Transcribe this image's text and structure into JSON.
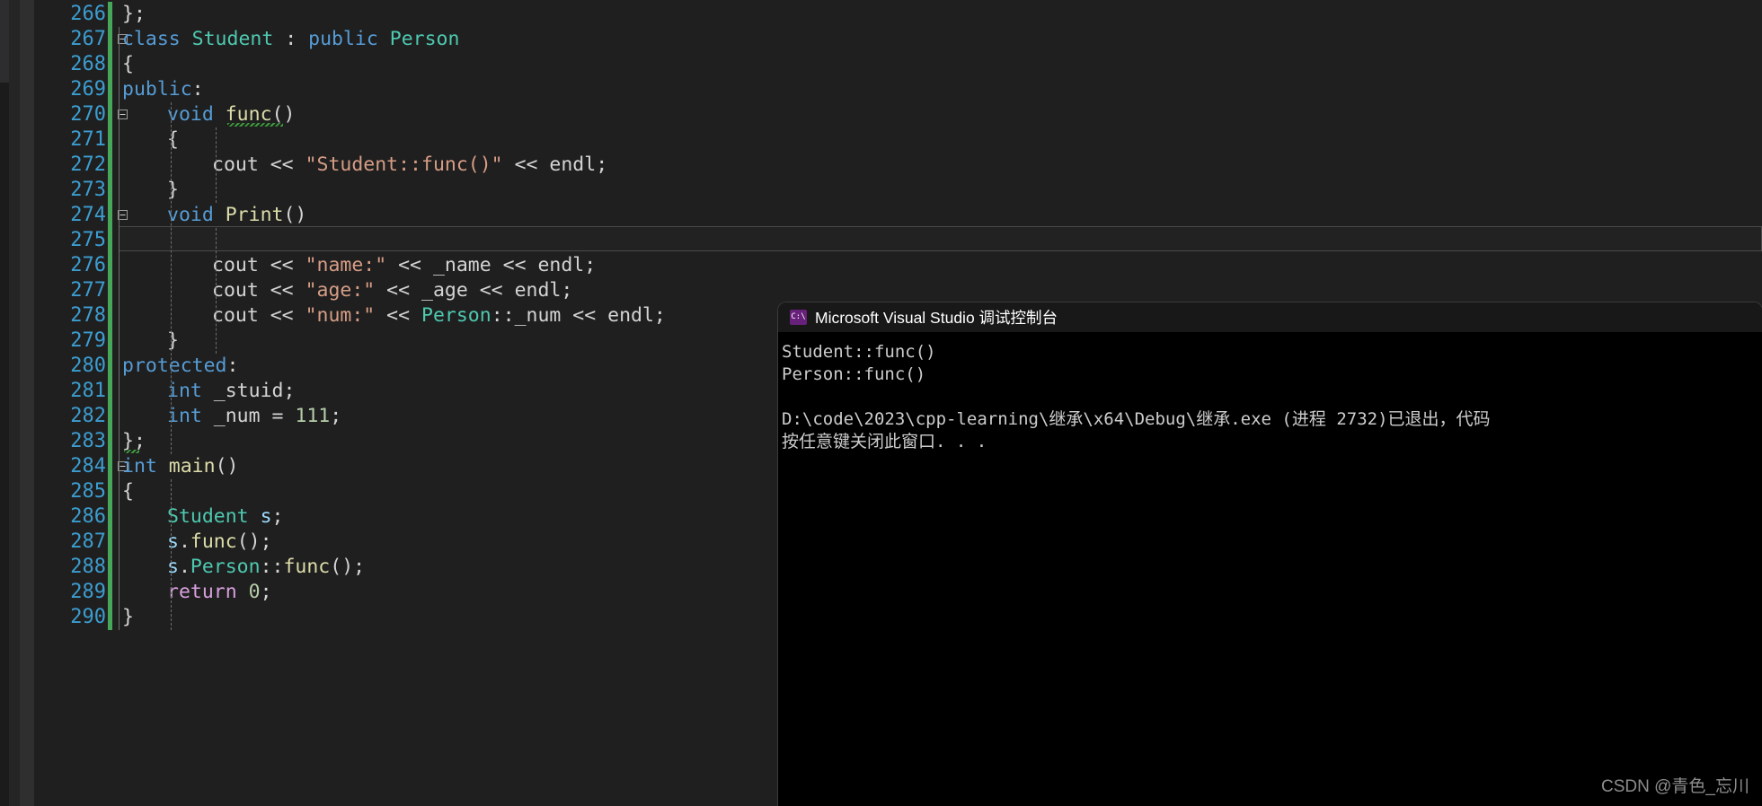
{
  "editor": {
    "first_line_number": 266,
    "lines": [
      {
        "n": "266",
        "fold": "",
        "indent": 0,
        "tokens": [
          {
            "t": "};",
            "c": "pl"
          }
        ]
      },
      {
        "n": "267",
        "fold": "minus",
        "indent": 0,
        "tokens": [
          {
            "t": "class ",
            "c": "kw"
          },
          {
            "t": "Student",
            "c": "ty"
          },
          {
            "t": " : ",
            "c": "pl"
          },
          {
            "t": "public",
            "c": "kw"
          },
          {
            "t": " ",
            "c": "pl"
          },
          {
            "t": "Person",
            "c": "ty"
          }
        ]
      },
      {
        "n": "268",
        "fold": "",
        "indent": 0,
        "tokens": [
          {
            "t": "{",
            "c": "pl"
          }
        ]
      },
      {
        "n": "269",
        "fold": "",
        "indent": 0,
        "tokens": [
          {
            "t": "public",
            "c": "kw"
          },
          {
            "t": ":",
            "c": "pl"
          }
        ]
      },
      {
        "n": "270",
        "fold": "minus",
        "indent": 1,
        "tokens": [
          {
            "t": "void",
            "c": "kw"
          },
          {
            "t": " ",
            "c": "pl"
          },
          {
            "t": "func",
            "c": "fn"
          },
          {
            "t": "()",
            "c": "pl"
          }
        ]
      },
      {
        "n": "271",
        "fold": "",
        "indent": 1,
        "tokens": [
          {
            "t": "{",
            "c": "pl"
          }
        ]
      },
      {
        "n": "272",
        "fold": "",
        "indent": 2,
        "tokens": [
          {
            "t": "cout",
            "c": "pl"
          },
          {
            "t": " << ",
            "c": "op"
          },
          {
            "t": "\"Student::func()\"",
            "c": "str"
          },
          {
            "t": " << ",
            "c": "op"
          },
          {
            "t": "endl",
            "c": "pl"
          },
          {
            "t": ";",
            "c": "pl"
          }
        ]
      },
      {
        "n": "273",
        "fold": "",
        "indent": 1,
        "tokens": [
          {
            "t": "}",
            "c": "pl"
          }
        ]
      },
      {
        "n": "274",
        "fold": "minus",
        "indent": 1,
        "tokens": [
          {
            "t": "void",
            "c": "kw"
          },
          {
            "t": " ",
            "c": "pl"
          },
          {
            "t": "Print",
            "c": "fn"
          },
          {
            "t": "()",
            "c": "pl"
          }
        ]
      },
      {
        "n": "275",
        "fold": "",
        "indent": 1,
        "tokens": [
          {
            "t": "{",
            "c": "pl"
          }
        ]
      },
      {
        "n": "276",
        "fold": "",
        "indent": 2,
        "tokens": [
          {
            "t": "cout",
            "c": "pl"
          },
          {
            "t": " << ",
            "c": "op"
          },
          {
            "t": "\"name:\"",
            "c": "str"
          },
          {
            "t": " << ",
            "c": "op"
          },
          {
            "t": "_name",
            "c": "pl"
          },
          {
            "t": " << ",
            "c": "op"
          },
          {
            "t": "endl",
            "c": "pl"
          },
          {
            "t": ";",
            "c": "pl"
          }
        ]
      },
      {
        "n": "277",
        "fold": "",
        "indent": 2,
        "tokens": [
          {
            "t": "cout",
            "c": "pl"
          },
          {
            "t": " << ",
            "c": "op"
          },
          {
            "t": "\"age:\"",
            "c": "str"
          },
          {
            "t": " << ",
            "c": "op"
          },
          {
            "t": "_age",
            "c": "pl"
          },
          {
            "t": " << ",
            "c": "op"
          },
          {
            "t": "endl",
            "c": "pl"
          },
          {
            "t": ";",
            "c": "pl"
          }
        ]
      },
      {
        "n": "278",
        "fold": "",
        "indent": 2,
        "tokens": [
          {
            "t": "cout",
            "c": "pl"
          },
          {
            "t": " << ",
            "c": "op"
          },
          {
            "t": "\"num:\"",
            "c": "str"
          },
          {
            "t": " << ",
            "c": "op"
          },
          {
            "t": "Person",
            "c": "ty"
          },
          {
            "t": "::_num",
            "c": "pl"
          },
          {
            "t": " << ",
            "c": "op"
          },
          {
            "t": "endl",
            "c": "pl"
          },
          {
            "t": ";",
            "c": "pl"
          }
        ]
      },
      {
        "n": "279",
        "fold": "",
        "indent": 1,
        "tokens": [
          {
            "t": "}",
            "c": "pl"
          }
        ]
      },
      {
        "n": "280",
        "fold": "",
        "indent": 0,
        "tokens": [
          {
            "t": "protected",
            "c": "kw"
          },
          {
            "t": ":",
            "c": "pl"
          }
        ]
      },
      {
        "n": "281",
        "fold": "",
        "indent": 1,
        "tokens": [
          {
            "t": "int",
            "c": "kw"
          },
          {
            "t": " _stuid;",
            "c": "pl"
          }
        ]
      },
      {
        "n": "282",
        "fold": "",
        "indent": 1,
        "tokens": [
          {
            "t": "int",
            "c": "kw"
          },
          {
            "t": " _num = ",
            "c": "pl"
          },
          {
            "t": "111",
            "c": "num"
          },
          {
            "t": ";",
            "c": "pl"
          }
        ]
      },
      {
        "n": "283",
        "fold": "",
        "indent": 0,
        "tokens": [
          {
            "t": "};",
            "c": "pl"
          }
        ]
      },
      {
        "n": "284",
        "fold": "minus",
        "indent": 0,
        "tokens": [
          {
            "t": "int",
            "c": "kw"
          },
          {
            "t": " ",
            "c": "pl"
          },
          {
            "t": "main",
            "c": "fn"
          },
          {
            "t": "()",
            "c": "pl"
          }
        ]
      },
      {
        "n": "285",
        "fold": "",
        "indent": 0,
        "tokens": [
          {
            "t": "{",
            "c": "pl"
          }
        ]
      },
      {
        "n": "286",
        "fold": "",
        "indent": 1,
        "tokens": [
          {
            "t": "Student",
            "c": "ty"
          },
          {
            "t": " ",
            "c": "pl"
          },
          {
            "t": "s",
            "c": "id"
          },
          {
            "t": ";",
            "c": "pl"
          }
        ]
      },
      {
        "n": "287",
        "fold": "",
        "indent": 1,
        "tokens": [
          {
            "t": "s",
            "c": "id"
          },
          {
            "t": ".",
            "c": "pl"
          },
          {
            "t": "func",
            "c": "fn"
          },
          {
            "t": "();",
            "c": "pl"
          }
        ]
      },
      {
        "n": "288",
        "fold": "",
        "indent": 1,
        "tokens": [
          {
            "t": "s",
            "c": "id"
          },
          {
            "t": ".",
            "c": "pl"
          },
          {
            "t": "Person",
            "c": "ty"
          },
          {
            "t": "::",
            "c": "pl"
          },
          {
            "t": "func",
            "c": "fn"
          },
          {
            "t": "();",
            "c": "pl"
          }
        ]
      },
      {
        "n": "289",
        "fold": "",
        "indent": 1,
        "tokens": [
          {
            "t": "return",
            "c": "ret"
          },
          {
            "t": " ",
            "c": "pl"
          },
          {
            "t": "0",
            "c": "num"
          },
          {
            "t": ";",
            "c": "pl"
          }
        ]
      },
      {
        "n": "290",
        "fold": "",
        "indent": 0,
        "tokens": [
          {
            "t": "}",
            "c": "pl"
          }
        ]
      }
    ],
    "current_line": "275",
    "colors": {
      "background": "#1f1f1f",
      "line_number": "#3c9dd0",
      "keyword": "#569cd6",
      "type": "#4ec9b0",
      "function": "#dcdcaa",
      "string": "#d69d85",
      "number": "#b5cea8",
      "return_keyword": "#d8a0df",
      "identifier": "#9cdcfe",
      "change_bar": "#46a758"
    }
  },
  "console": {
    "icon": "console-cmd-icon",
    "icon_text": "C:\\",
    "title": "Microsoft Visual Studio 调试控制台",
    "lines": [
      "Student::func()",
      "Person::func()",
      "",
      "D:\\code\\2023\\cpp-learning\\继承\\x64\\Debug\\继承.exe (进程 2732)已退出，代码",
      "按任意键关闭此窗口. . ."
    ]
  },
  "watermark": {
    "text": "CSDN @青色_忘川"
  }
}
